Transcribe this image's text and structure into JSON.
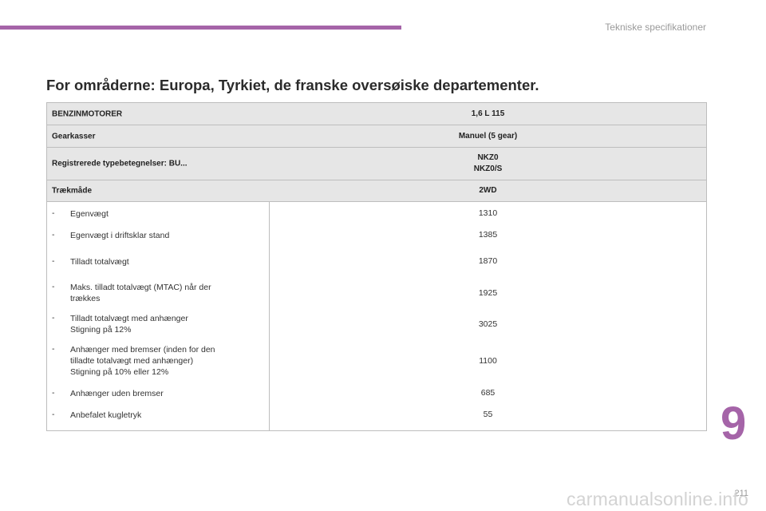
{
  "header": {
    "section_title": "Tekniske specifikationer",
    "accent_color": "#a564a8"
  },
  "heading": "For områderne: Europa, Tyrkiet, de franske oversøiske departementer.",
  "table": {
    "engine_header": {
      "label": "BENZINMOTORER",
      "value": "1,6 L 115"
    },
    "gearbox": {
      "label": "Gearkasser",
      "value": "Manuel (5 gear)"
    },
    "type_designations": {
      "label": "Registrerede typebetegnelser: BU...",
      "values": [
        "NKZ0",
        "NKZ0/S"
      ]
    },
    "drive": {
      "label": "Trækmåde",
      "value": "2WD"
    },
    "rows": [
      {
        "lines": [
          "Egenvægt"
        ],
        "value": "1310"
      },
      {
        "lines": [
          "Egenvægt i driftsklar stand"
        ],
        "value": "1385"
      },
      {
        "lines": [
          "Tilladt totalvægt"
        ],
        "value": "1870"
      },
      {
        "lines": [
          "Maks. tilladt totalvægt (MTAC) når der",
          "trækkes"
        ],
        "value": "1925"
      },
      {
        "lines": [
          "Tilladt totalvægt med anhænger",
          "Stigning på 12%"
        ],
        "value": "3025"
      },
      {
        "lines": [
          "Anhænger med bremser (inden for den",
          "tilladte totalvægt med anhænger)",
          "Stigning på 10% eller 12%"
        ],
        "value": "1100"
      },
      {
        "lines": [
          "Anhænger uden bremser"
        ],
        "value": "685"
      },
      {
        "lines": [
          "Anbefalet kugletryk"
        ],
        "value": "55"
      }
    ]
  },
  "chapter_number": "9",
  "page_number": "211",
  "watermark": "carmanualsonline.info"
}
